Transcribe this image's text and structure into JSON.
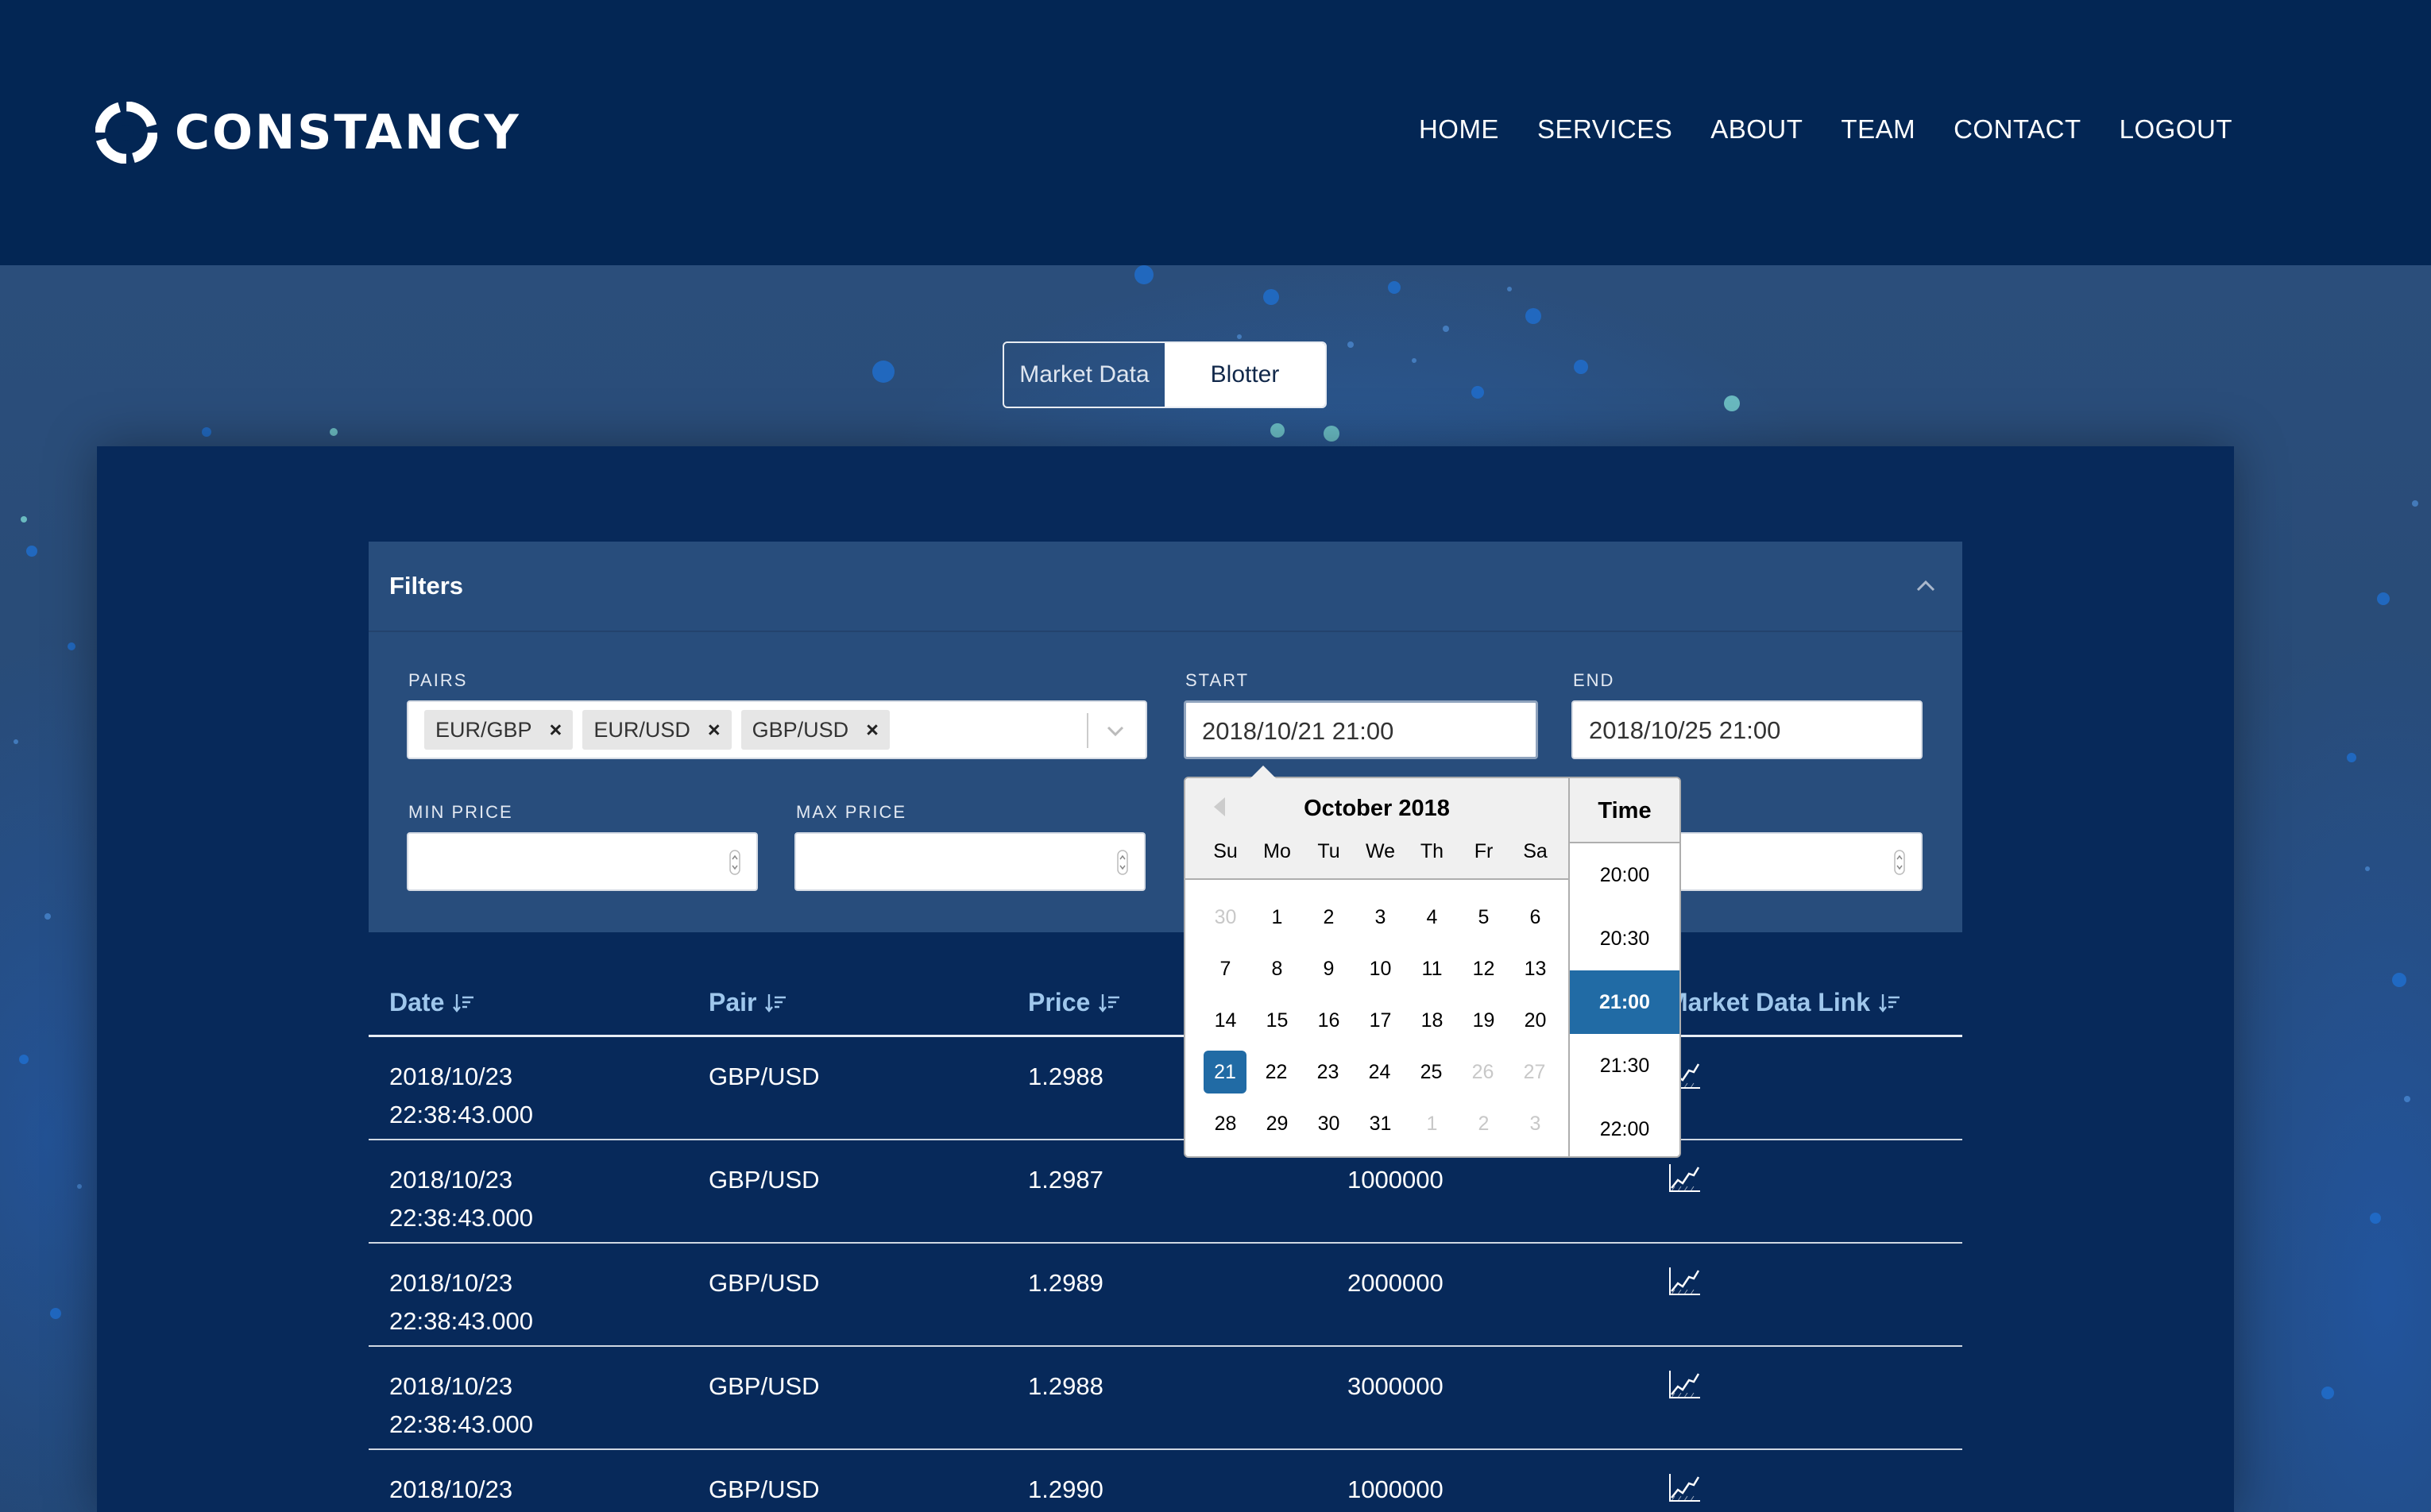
{
  "brand": {
    "name": "CONSTANCY"
  },
  "nav": [
    "HOME",
    "SERVICES",
    "ABOUT",
    "TEAM",
    "CONTACT",
    "LOGOUT"
  ],
  "view_toggle": {
    "options": [
      "Market Data",
      "Blotter"
    ],
    "selected": "Blotter"
  },
  "filters": {
    "title": "Filters",
    "pairs_label": "PAIRS",
    "pairs": [
      "EUR/GBP",
      "EUR/USD",
      "GBP/USD"
    ],
    "start_label": "START",
    "start_value": "2018/10/21 21:00",
    "end_label": "END",
    "end_value": "2018/10/25 21:00",
    "min_price_label": "MIN PRICE",
    "min_price_value": "",
    "max_price_label": "MAX PRICE",
    "max_price_value": "",
    "hidden_field_value": ""
  },
  "table": {
    "columns": [
      "Date",
      "Pair",
      "Price",
      "",
      "Market Data Link"
    ],
    "rows": [
      {
        "date": "2018/10/23",
        "time": "22:38:43.000",
        "pair": "GBP/USD",
        "price": "1.2988",
        "amount": ""
      },
      {
        "date": "2018/10/23",
        "time": "22:38:43.000",
        "pair": "GBP/USD",
        "price": "1.2987",
        "amount": "1000000"
      },
      {
        "date": "2018/10/23",
        "time": "22:38:43.000",
        "pair": "GBP/USD",
        "price": "1.2989",
        "amount": "2000000"
      },
      {
        "date": "2018/10/23",
        "time": "22:38:43.000",
        "pair": "GBP/USD",
        "price": "1.2988",
        "amount": "3000000"
      },
      {
        "date": "2018/10/23",
        "time": "22:38:43.000",
        "pair": "GBP/USD",
        "price": "1.2990",
        "amount": "1000000"
      }
    ]
  },
  "datepicker": {
    "month": "October 2018",
    "weekdays": [
      "Su",
      "Mo",
      "Tu",
      "We",
      "Th",
      "Fr",
      "Sa"
    ],
    "weeks": [
      [
        "30",
        "1",
        "2",
        "3",
        "4",
        "5",
        "6"
      ],
      [
        "7",
        "8",
        "9",
        "10",
        "11",
        "12",
        "13"
      ],
      [
        "14",
        "15",
        "16",
        "17",
        "18",
        "19",
        "20"
      ],
      [
        "21",
        "22",
        "23",
        "24",
        "25",
        "26",
        "27"
      ],
      [
        "28",
        "29",
        "30",
        "31",
        "1",
        "2",
        "3"
      ]
    ],
    "selected_day": "21",
    "time_header": "Time",
    "times": [
      "20:00",
      "20:30",
      "21:00",
      "21:30",
      "22:00"
    ],
    "selected_time": "21:00"
  },
  "colors": {
    "header_bg": "#032654",
    "panel_bg": "#07295a",
    "filters_bg": "#284d7c",
    "accent": "#216ba5",
    "column_header": "#9fc7ec"
  }
}
